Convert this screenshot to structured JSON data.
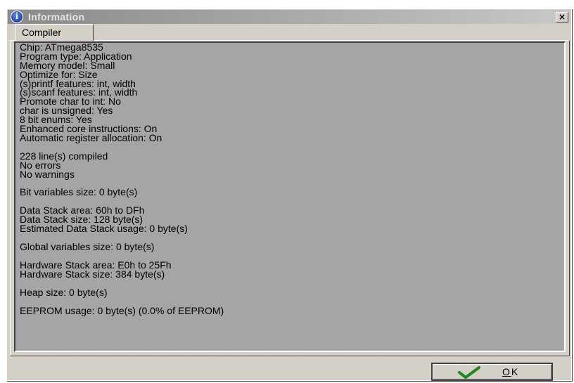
{
  "window": {
    "title": "Information",
    "close_symbol": "×",
    "title_icon": "info-icon"
  },
  "tabs": [
    {
      "label": "Compiler",
      "active": true
    }
  ],
  "output": {
    "lines": [
      "Chip: ATmega8535",
      "Program type: Application",
      "Memory model: Small",
      "Optimize for: Size",
      "(s)printf features: int, width",
      "(s)scanf features: int, width",
      "Promote char to int: No",
      "char is unsigned: Yes",
      "8 bit enums: Yes",
      "Enhanced core instructions: On",
      "Automatic register allocation: On",
      "",
      "228 line(s) compiled",
      "No errors",
      "No warnings",
      "",
      "Bit variables size: 0 byte(s)",
      "",
      "Data Stack area: 60h to DFh",
      "Data Stack size: 128 byte(s)",
      "Estimated Data Stack usage: 0 byte(s)",
      "",
      "Global variables size: 0 byte(s)",
      "",
      "Hardware Stack area: E0h to 25Fh",
      "Hardware Stack size: 384 byte(s)",
      "",
      "Heap size: 0 byte(s)",
      "",
      "EEPROM usage: 0 byte(s) (0.0% of EEPROM)"
    ]
  },
  "ok_button": {
    "label_underlined": "O",
    "label_rest": "K",
    "icon": "checkmark-icon",
    "icon_color": "#1a8a1a"
  },
  "colors": {
    "dialog_bg": "#d4d0c8",
    "output_bg": "#a5a5a5",
    "titlebar_inactive": "#8a8a8a"
  }
}
